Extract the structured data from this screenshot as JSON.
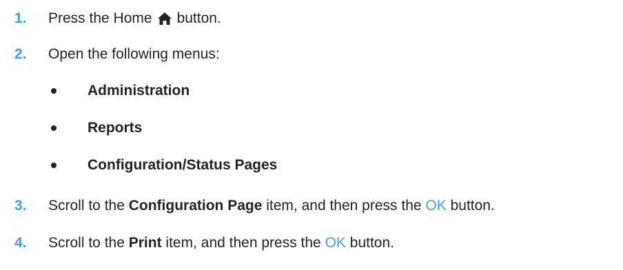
{
  "steps": {
    "s1": {
      "number": "1.",
      "text_before": "Press the Home",
      "text_after": "button."
    },
    "s2": {
      "number": "2.",
      "text": "Open the following menus:"
    },
    "menus": [
      "Administration",
      "Reports",
      "Configuration/Status Pages"
    ],
    "s3": {
      "number": "3.",
      "text_before": "Scroll to the",
      "item": "Configuration Page",
      "text_middle": "item, and then press the",
      "ok": "OK",
      "text_after": "button."
    },
    "s4": {
      "number": "4.",
      "text_before": "Scroll to the",
      "item": "Print",
      "text_middle": "item, and then press the",
      "ok": "OK",
      "text_after": "button."
    }
  },
  "icons": {
    "home": "home-icon"
  },
  "colors": {
    "step_number": "#3f9fe0",
    "ok_label": "#3f9fe0",
    "text": "#222222"
  }
}
